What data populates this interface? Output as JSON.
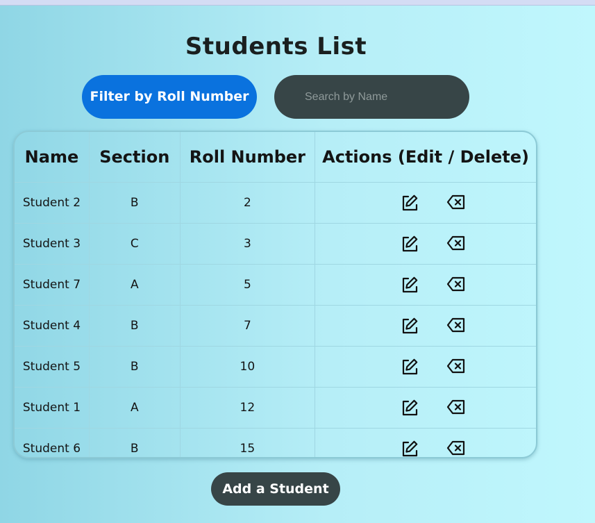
{
  "page": {
    "title": "Students List"
  },
  "controls": {
    "filter_label": "Filter by Roll Number",
    "search_placeholder": "Search by Name",
    "search_value": ""
  },
  "table": {
    "headers": [
      "Name",
      "Section",
      "Roll Number",
      "Actions (Edit / Delete)"
    ],
    "rows": [
      {
        "name": "Student 2",
        "section": "B",
        "roll": "2"
      },
      {
        "name": "Student 3",
        "section": "C",
        "roll": "3"
      },
      {
        "name": "Student 7",
        "section": "A",
        "roll": "5"
      },
      {
        "name": "Student 4",
        "section": "B",
        "roll": "7"
      },
      {
        "name": "Student 5",
        "section": "B",
        "roll": "10"
      },
      {
        "name": "Student 1",
        "section": "A",
        "roll": "12"
      },
      {
        "name": "Student 6",
        "section": "B",
        "roll": "15"
      }
    ],
    "action_icons": {
      "edit": "edit-square-pen-icon",
      "delete": "backspace-x-icon"
    }
  },
  "footer": {
    "add_label": "Add a Student"
  },
  "colors": {
    "primary": "#0a72de",
    "dark": "#374547",
    "background_start": "#8fd6e5",
    "background_end": "#c0f7fd"
  }
}
